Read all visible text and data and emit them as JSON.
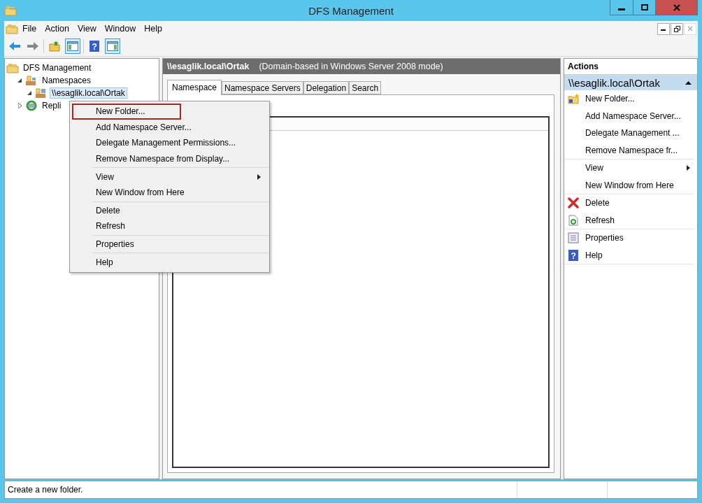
{
  "window": {
    "title": "DFS Management"
  },
  "menu": [
    "File",
    "Action",
    "View",
    "Window",
    "Help"
  ],
  "toolbar": [
    {
      "kind": "back",
      "pressed": false
    },
    {
      "kind": "forward",
      "pressed": false
    },
    {
      "kind": "up",
      "pressed": false
    },
    {
      "kind": "tree",
      "pressed": true
    },
    {
      "kind": "help",
      "pressed": false,
      "glyph": "?"
    },
    {
      "kind": "actionpane",
      "pressed": true
    }
  ],
  "tree": [
    {
      "label": "DFS Management",
      "kind": "root",
      "selected": false,
      "children": [
        {
          "label": "Namespaces",
          "kind": "namespaces",
          "selected": false,
          "expanded": true,
          "children": [
            {
              "label": "\\\\esaglik.local\\Ortak",
              "kind": "namespace",
              "selected": true,
              "expanded": true
            }
          ]
        },
        {
          "label": "Repli",
          "kind": "replication",
          "selected": false,
          "expanded": false
        }
      ]
    }
  ],
  "context_menu": {
    "groups": [
      [
        {
          "label": "New Folder...",
          "selected": true,
          "submenu": false
        },
        {
          "label": "Add Namespace Server...",
          "selected": false,
          "submenu": false
        },
        {
          "label": "Delegate Management Permissions...",
          "selected": false,
          "submenu": false
        },
        {
          "label": "Remove Namespace from Display...",
          "selected": false,
          "submenu": false
        }
      ],
      [
        {
          "label": "View",
          "selected": false,
          "submenu": true
        },
        {
          "label": "New Window from Here",
          "selected": false,
          "submenu": false
        }
      ],
      [
        {
          "label": "Delete",
          "selected": false,
          "submenu": false
        },
        {
          "label": "Refresh",
          "selected": false,
          "submenu": false
        }
      ],
      [
        {
          "label": "Properties",
          "selected": false,
          "submenu": false
        }
      ],
      [
        {
          "label": "Help",
          "selected": false,
          "submenu": false
        }
      ]
    ]
  },
  "details": {
    "title": "\\\\esaglik.local\\Ortak",
    "subtitle": "(Domain-based in Windows Server 2008 mode)",
    "tabs": [
      {
        "label": "Namespace",
        "selected": true
      },
      {
        "label": "Namespace Servers",
        "selected": false
      },
      {
        "label": "Delegation",
        "selected": false
      },
      {
        "label": "Search",
        "selected": false
      }
    ]
  },
  "actions": {
    "title": "Actions",
    "section": "\\\\esaglik.local\\Ortak",
    "groups": [
      [
        {
          "label": "New Folder...",
          "kind": "newfolder",
          "submenu": false
        },
        {
          "label": "Add Namespace Server...",
          "kind": "plain",
          "submenu": false
        },
        {
          "label": "Delegate Management ...",
          "kind": "plain",
          "submenu": false
        },
        {
          "label": "Remove Namespace fr...",
          "kind": "plain",
          "submenu": false
        }
      ],
      [
        {
          "label": "View",
          "kind": "plain",
          "submenu": true
        },
        {
          "label": "New Window from Here",
          "kind": "plain",
          "submenu": false
        }
      ],
      [
        {
          "label": "Delete",
          "kind": "delete",
          "submenu": false
        },
        {
          "label": "Refresh",
          "kind": "refresh",
          "submenu": false
        }
      ],
      [
        {
          "label": "Properties",
          "kind": "properties",
          "submenu": false
        },
        {
          "label": "Help",
          "kind": "help",
          "submenu": false,
          "glyph": "?"
        }
      ]
    ]
  },
  "status_bar": {
    "text": "Create a new folder."
  }
}
